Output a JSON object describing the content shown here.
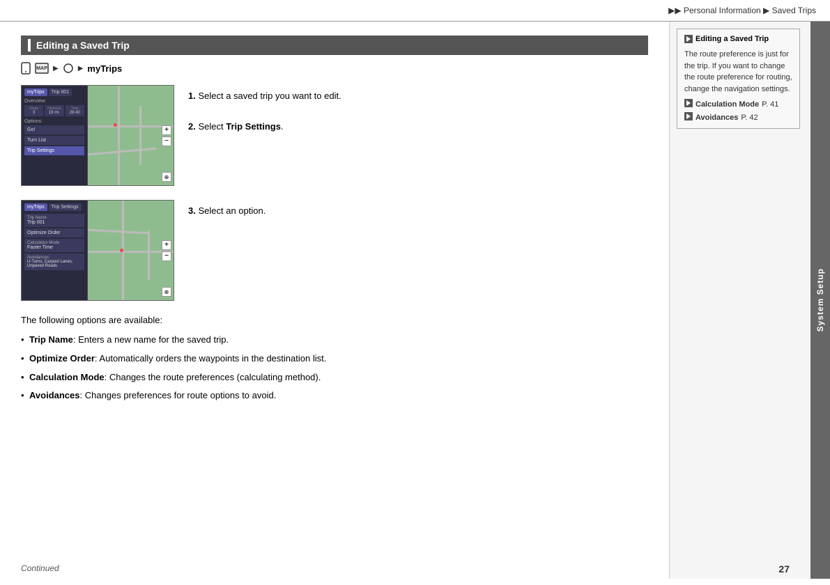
{
  "breadcrumb": {
    "prefix": "▶▶",
    "part1": "Personal Information",
    "arrow1": "▶",
    "part2": "Saved Trips"
  },
  "section": {
    "title": "Editing a Saved Trip"
  },
  "path": {
    "icons": [
      "phone",
      "map"
    ],
    "arrow1": "▶",
    "circle": "",
    "arrow2": "▶",
    "label": "myTrips"
  },
  "steps": [
    {
      "number": "1.",
      "text": "Select a saved trip you want to edit."
    },
    {
      "number": "2.",
      "text_prefix": "Select ",
      "text_bold": "Trip Settings",
      "text_suffix": "."
    },
    {
      "number": "3.",
      "text": "Select an option."
    }
  ],
  "following_text": "The following options are available:",
  "bullets": [
    {
      "bold": "Trip Name",
      "text": ": Enters a new name for the saved trip."
    },
    {
      "bold": "Optimize Order",
      "text": ": Automatically orders the waypoints in the destination list."
    },
    {
      "bold": "Calculation Mode",
      "text": ": Changes the route preferences (calculating method)."
    },
    {
      "bold": "Avoidances",
      "text": ": Changes preferences for route options to avoid."
    }
  ],
  "sidebar": {
    "title_icon": "▶",
    "title": "Editing a Saved Trip",
    "body": "The route preference is just for the trip. If you want to change the route preference for routing, change the navigation settings.",
    "links": [
      {
        "icon": "▶",
        "bold": "Calculation Mode",
        "text": " P. 41"
      },
      {
        "icon": "▶",
        "bold": "Avoidances",
        "text": " P. 42"
      }
    ],
    "vertical_label": "System Setup"
  },
  "footer": {
    "continued": "Continued",
    "page_number": "27"
  },
  "nav_screen_1": {
    "tabs": [
      "myTrips",
      "Trip 001"
    ],
    "section": "Overview:",
    "stats": [
      {
        "label": "Stops",
        "value": "3"
      },
      {
        "label": "Distance",
        "value": "19 mi."
      },
      {
        "label": "Time",
        "value": "28:40"
      }
    ],
    "section2": "Options:",
    "menu_items": [
      "Go!",
      "Turn List",
      "Trip Settings"
    ]
  },
  "nav_screen_2": {
    "tabs": [
      "myTrips",
      "Trip Settings"
    ],
    "items": [
      {
        "label": "Trip Name",
        "value": "Trip 001"
      },
      {
        "label": "Optimize Order",
        "selected": false
      },
      {
        "label": "Calculation Mode",
        "value": "Faster Time"
      },
      {
        "label": "Avoidances",
        "value": "U-Turns, Carpool Lanes, Unpaved Roads"
      }
    ]
  }
}
